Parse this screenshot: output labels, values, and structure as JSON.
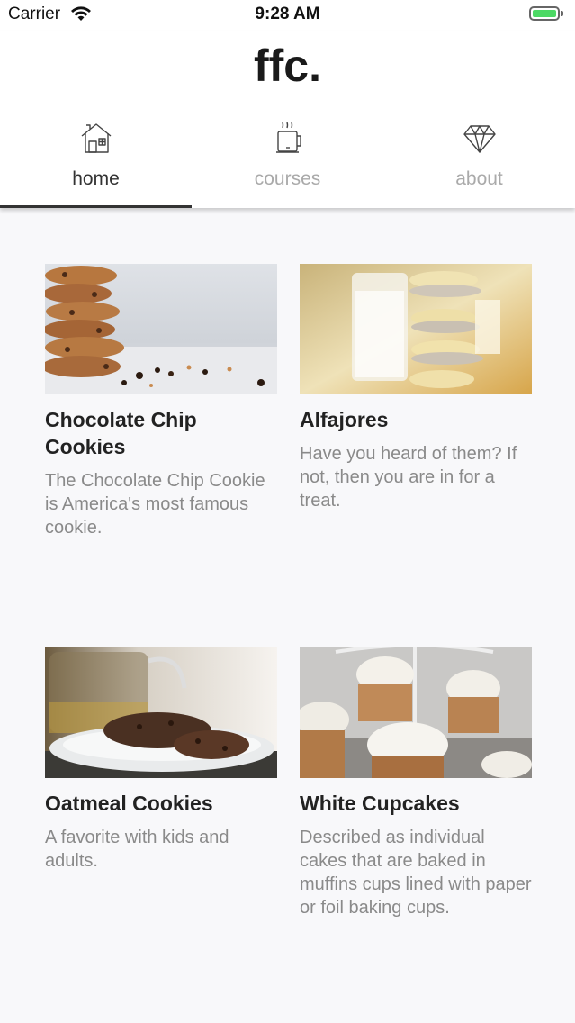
{
  "status_bar": {
    "carrier": "Carrier",
    "time": "9:28 AM",
    "battery_level": 1.0,
    "battery_color": "#4cd964"
  },
  "header": {
    "logo": "ffc."
  },
  "tabs": [
    {
      "label": "home",
      "icon": "house-icon",
      "active": true
    },
    {
      "label": "courses",
      "icon": "coffee-cup-icon",
      "active": false
    },
    {
      "label": "about",
      "icon": "diamond-icon",
      "active": false
    }
  ],
  "colors": {
    "active_tab": "#333333",
    "inactive_tab": "#aaaaaa",
    "card_title": "#222222",
    "card_desc": "#8a8a8a",
    "background": "#f8f8fa"
  },
  "cards": [
    {
      "title": "Chocolate Chip Cookies",
      "description": "The Chocolate Chip Cookie is America's most famous cookie.",
      "image": "chocolate-chip-cookies-image"
    },
    {
      "title": "Alfajores",
      "description": "Have you heard of them? If not, then you are in for a treat.",
      "image": "alfajores-image"
    },
    {
      "title": "Oatmeal Cookies",
      "description": "A favorite with kids and adults.",
      "image": "oatmeal-cookies-image"
    },
    {
      "title": "White Cupcakes",
      "description": "Described as individual cakes that are baked in muffins cups lined with paper or foil baking cups.",
      "image": "white-cupcakes-image"
    }
  ]
}
